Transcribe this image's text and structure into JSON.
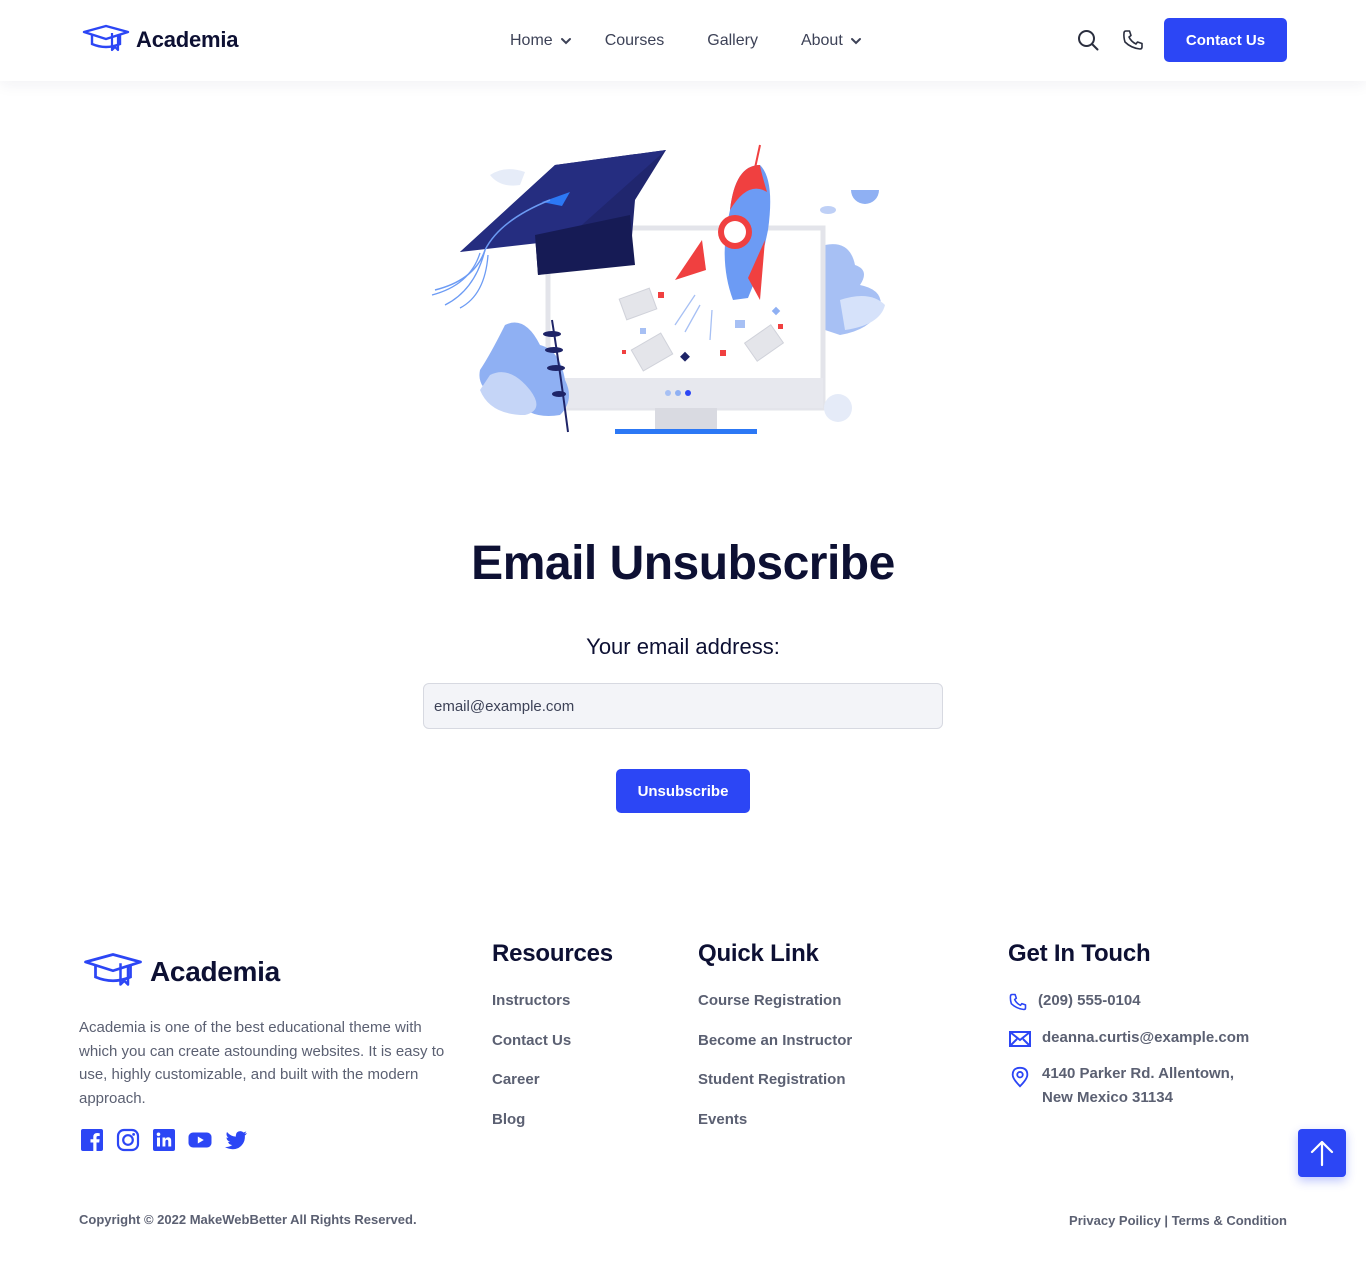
{
  "header": {
    "brand": "Academia",
    "nav": [
      {
        "label": "Home",
        "has_dropdown": true
      },
      {
        "label": "Courses",
        "has_dropdown": false
      },
      {
        "label": "Gallery",
        "has_dropdown": false
      },
      {
        "label": "About",
        "has_dropdown": true
      }
    ],
    "icons": [
      "search-icon",
      "phone-icon"
    ],
    "contact_button": "Contact Us"
  },
  "main": {
    "title": "Email Unsubscribe",
    "email_label": "Your email address:",
    "email_placeholder": "email@example.com",
    "unsubscribe_button": "Unsubscribe"
  },
  "footer": {
    "brand": "Academia",
    "description": "Academia is one of the best educational theme with which you can create astounding websites. It is easy to use, highly customizable, and built with the modern approach.",
    "socials": [
      "facebook-icon",
      "instagram-icon",
      "linkedin-icon",
      "youtube-icon",
      "twitter-icon"
    ],
    "resources": {
      "title": "Resources",
      "links": [
        "Instructors",
        "Contact Us",
        "Career",
        "Blog"
      ]
    },
    "quick_link": {
      "title": "Quick Link",
      "links": [
        "Course Registration",
        "Become an Instructor",
        "Student Registration",
        "Events"
      ]
    },
    "get_in_touch": {
      "title": "Get In Touch",
      "phone": "(209) 555-0104",
      "email": "deanna.curtis@example.com",
      "address_line1": "4140 Parker Rd. Allentown,",
      "address_line2": "New Mexico 31134"
    },
    "copyright": "Copyright © 2022 MakeWebBetter All Rights Reserved.",
    "privacy": "Privacy Poilicy",
    "separator": " | ",
    "terms": "Terms & Condition"
  },
  "colors": {
    "accent": "#2c46f5",
    "heading": "#0d1033",
    "text": "#5b6072"
  }
}
